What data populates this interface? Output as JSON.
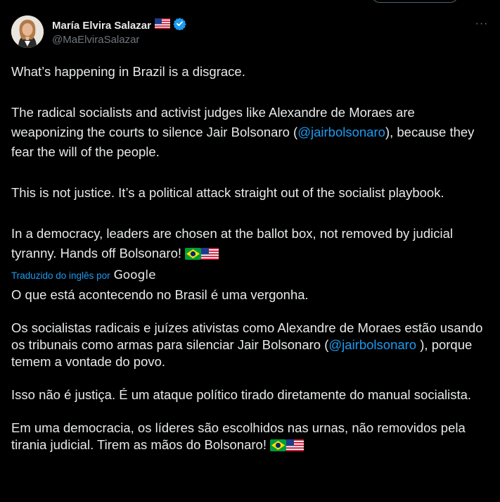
{
  "author": {
    "display_name": "María Elvira Salazar",
    "handle": "@MaElviraSalazar",
    "flag_icon": "us-flag-icon",
    "verified_icon": "verified-badge-icon"
  },
  "menu": {
    "more_label": "···"
  },
  "tweet": {
    "p1": "What’s happening in Brazil is a disgrace.",
    "p2_before": "The radical socialists and activist judges like Alexandre de Moraes are weaponizing the courts to silence Jair Bolsonaro (",
    "p2_mention": "@jairbolsonaro",
    "p2_after": "), because they fear the will of the people.",
    "p3": "This is not justice. It’s a political attack straight out of the socialist playbook.",
    "p4": "In a democracy, leaders are chosen at the ballot box, not removed by judicial tyranny. Hands off Bolsonaro!"
  },
  "translation": {
    "label": "Traduzido do inglês por",
    "provider": "Google",
    "p1": "O que está acontecendo no Brasil é uma vergonha.",
    "p2_before": "Os socialistas radicais e juízes ativistas como Alexandre de Moraes estão usando os tribunais como armas para silenciar Jair Bolsonaro (",
    "p2_mention": "@jairbolsonaro",
    "p2_after": " ), porque temem a vontade do povo.",
    "p3": "Isso não é justiça. É um ataque político tirado diretamente do manual socialista.",
    "p4": "Em uma democracia, os líderes são escolhidos nas urnas, não removidos pela tirania judicial. Tirem as mãos do Bolsonaro!"
  },
  "colors": {
    "background": "#000000",
    "text": "#e7e9ea",
    "secondary": "#71767b",
    "link": "#1d9bf0"
  }
}
